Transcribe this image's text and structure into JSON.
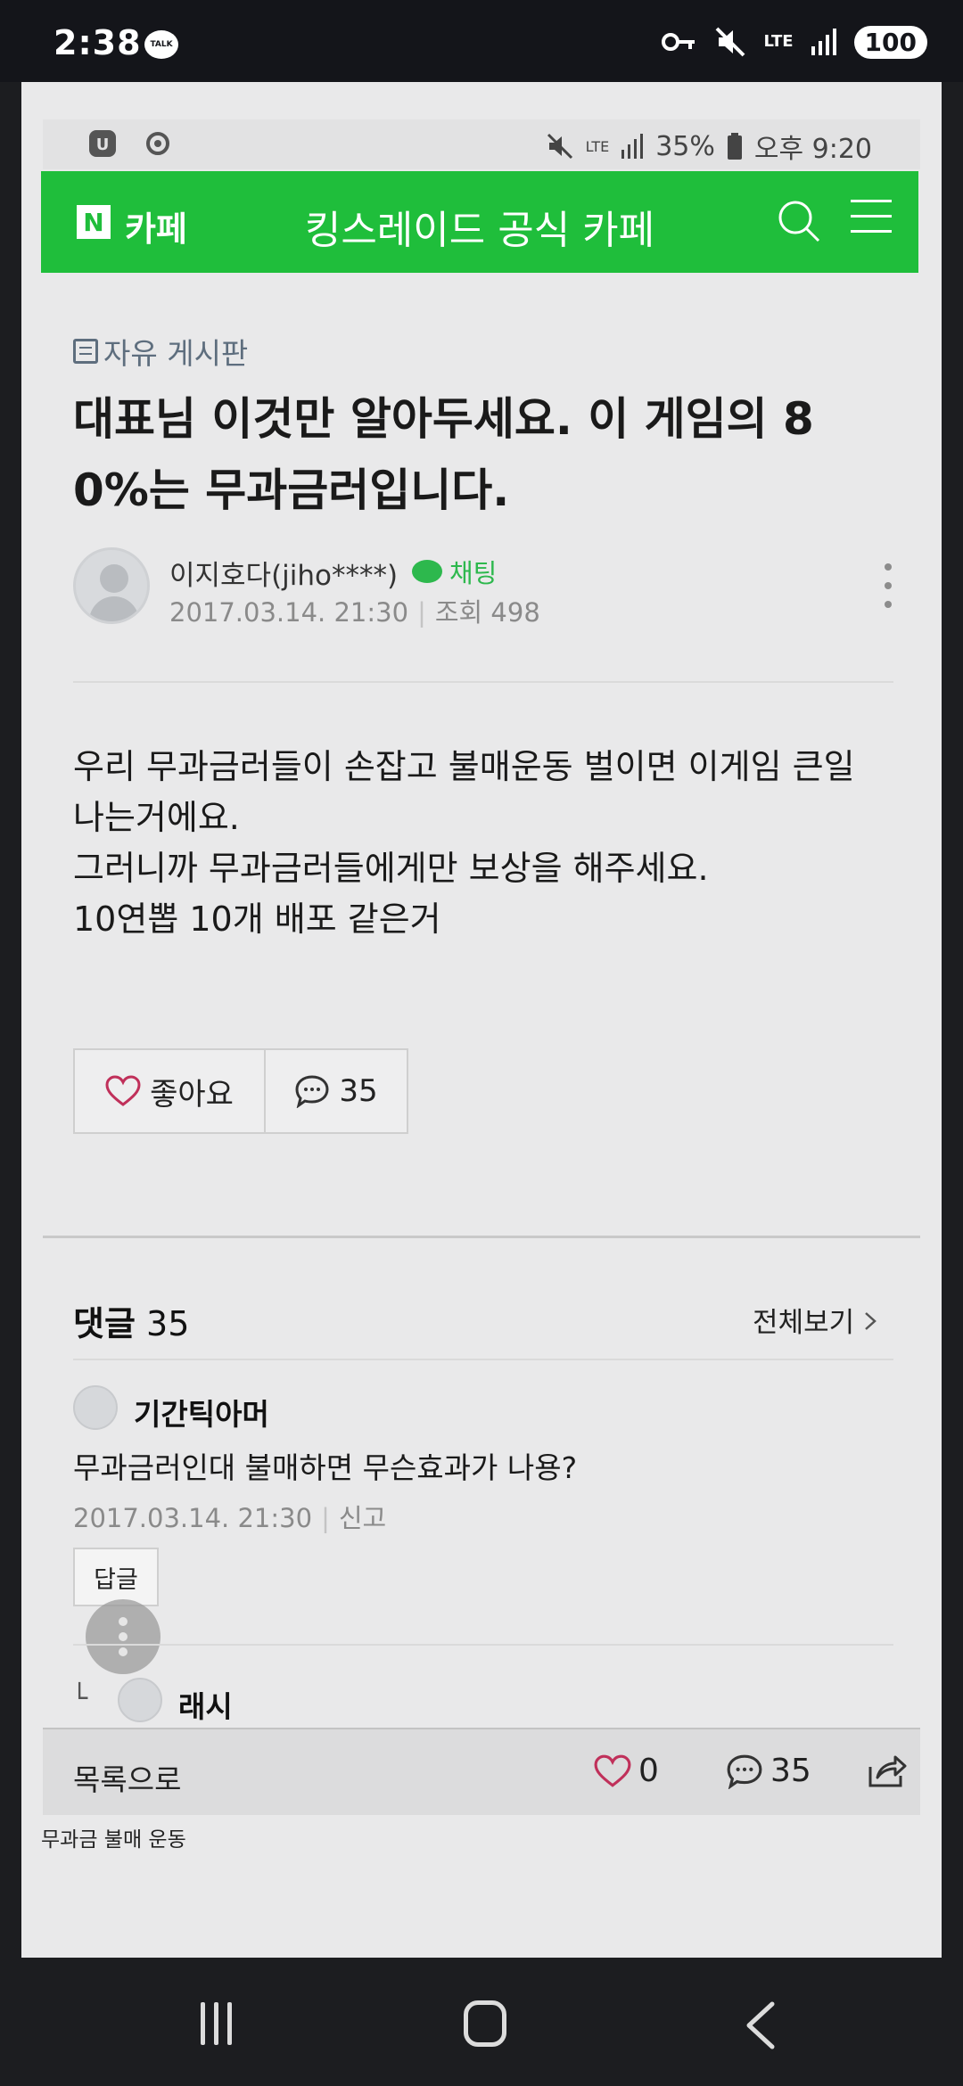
{
  "phone_status": {
    "time": "2:38",
    "talk_badge": "TALK",
    "network": "LTE",
    "battery": "100"
  },
  "inner_status": {
    "network": "LTE",
    "battery": "35%",
    "time": "오후 9:20"
  },
  "header": {
    "logo": "N",
    "cafe_label": "카페",
    "title": "킹스레이드 공식 카페"
  },
  "post": {
    "board": "자유 게시판",
    "title": "대표님 이것만 알아두세요. 이 게임의 8 0%는 무과금러입니다.",
    "author": "이지호다(jiho****)",
    "chat_label": "채팅",
    "date": "2017.03.14. 21:30",
    "views": "조회 498",
    "body": [
      "우리 무과금러들이 손잡고 불매운동 벌이면 이게임 큰일 나는거에요.",
      "그러니까 무과금러들에게만 보상을 해주세요.",
      "10연뽑 10개 배포 같은거"
    ],
    "like_label": "좋아요",
    "comment_count": "35"
  },
  "comments": {
    "heading_label": "댓글",
    "count": "35",
    "view_all": "전체보기",
    "items": [
      {
        "author": "기간틱아머",
        "text": "무과금러인대 불매하면 무슨효과가 나용?",
        "date": "2017.03.14. 21:30",
        "report": "신고",
        "reply_label": "답글"
      },
      {
        "author": "래시"
      }
    ]
  },
  "bottom_bar": {
    "list_label": "목록으로",
    "likes": "0",
    "comments": "35"
  },
  "footer_caption": "무과금 불매 운동"
}
